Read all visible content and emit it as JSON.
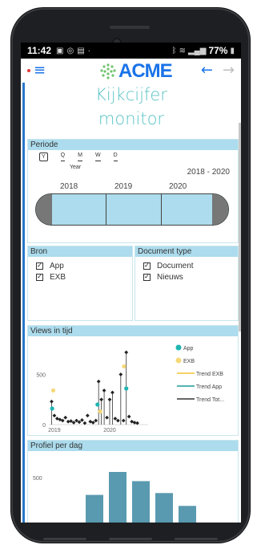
{
  "status_bar": {
    "time": "11:42",
    "icons": [
      "image-icon",
      "whatsapp-icon",
      "message-icon"
    ],
    "separator": "·",
    "battery": "77%"
  },
  "header": {
    "logo_text": "ACME",
    "menu_icon": "hamburger-icon",
    "back_icon": "arrow-left-icon",
    "forward_icon": "arrow-right-icon",
    "colors": {
      "accent": "#1a73e8",
      "teal": "#5cc3c4",
      "panel_head": "#acdced"
    }
  },
  "report": {
    "title_line1": "Kijkcijfer",
    "title_line2": "monitor",
    "periode": {
      "header": "Periode",
      "options": [
        "Y",
        "Q",
        "M",
        "W",
        "D"
      ],
      "selected": "Y",
      "label": "Year",
      "range": "2018 - 2020",
      "years": [
        "2018",
        "2019",
        "2020"
      ]
    },
    "bron": {
      "header": "Bron",
      "items": [
        {
          "label": "App",
          "checked": true
        },
        {
          "label": "EXB",
          "checked": true
        }
      ]
    },
    "document_type": {
      "header": "Document type",
      "items": [
        {
          "label": "Document",
          "checked": true
        },
        {
          "label": "Nieuws",
          "checked": true
        }
      ]
    },
    "views": {
      "header": "Views in tijd",
      "legend": [
        {
          "label": "App",
          "color": "#1fb5b1",
          "kind": "dot"
        },
        {
          "label": "EXB",
          "color": "#f5d97a",
          "kind": "dot"
        },
        {
          "label": "Trend EXB",
          "color": "#f4c430",
          "kind": "line"
        },
        {
          "label": "Trend App",
          "color": "#1a9c96",
          "kind": "line"
        },
        {
          "label": "Trend Tot...",
          "color": "#333333",
          "kind": "line"
        }
      ]
    },
    "profiel": {
      "header": "Profiel per dag"
    }
  },
  "chart_data": [
    {
      "type": "scatter",
      "title": "Views in tijd",
      "xlabel": "",
      "ylabel": "",
      "x_ticks": [
        "2019",
        "2020"
      ],
      "y_ticks": [
        0,
        500
      ],
      "ylim": [
        0,
        800
      ],
      "series": [
        {
          "name": "App",
          "points": [
            [
              2018.96,
              160
            ],
            [
              2019.78,
              200
            ],
            [
              2020.3,
              360
            ]
          ]
        },
        {
          "name": "EXB",
          "points": [
            [
              2018.98,
              340
            ],
            [
              2019.83,
              130
            ],
            [
              2020.26,
              580
            ]
          ]
        },
        {
          "name": "Trend Tot...",
          "points": [
            [
              2018.95,
              230
            ],
            [
              2019.0,
              90
            ],
            [
              2019.05,
              60
            ],
            [
              2019.1,
              50
            ],
            [
              2019.15,
              40
            ],
            [
              2019.2,
              70
            ],
            [
              2019.25,
              30
            ],
            [
              2019.3,
              35
            ],
            [
              2019.35,
              20
            ],
            [
              2019.4,
              40
            ],
            [
              2019.45,
              25
            ],
            [
              2019.5,
              45
            ],
            [
              2019.55,
              15
            ],
            [
              2019.6,
              90
            ],
            [
              2019.65,
              30
            ],
            [
              2019.7,
              20
            ],
            [
              2019.75,
              40
            ],
            [
              2019.8,
              430
            ],
            [
              2019.85,
              250
            ],
            [
              2019.9,
              340
            ],
            [
              2019.95,
              70
            ],
            [
              2020.0,
              250
            ],
            [
              2020.05,
              320
            ],
            [
              2020.1,
              60
            ],
            [
              2020.15,
              40
            ],
            [
              2020.2,
              500
            ],
            [
              2020.25,
              40
            ],
            [
              2020.3,
              720
            ],
            [
              2020.35,
              80
            ],
            [
              2020.4,
              30
            ],
            [
              2020.45,
              20
            ],
            [
              2020.5,
              15
            ]
          ]
        }
      ],
      "legend_position": "right"
    },
    {
      "type": "bar",
      "title": "Profiel per dag",
      "categories": [
        "",
        "",
        "",
        "",
        ""
      ],
      "values": [
        310,
        560,
        460,
        330,
        190
      ],
      "y_ticks": [
        500
      ],
      "ylim": [
        0,
        700
      ]
    }
  ]
}
